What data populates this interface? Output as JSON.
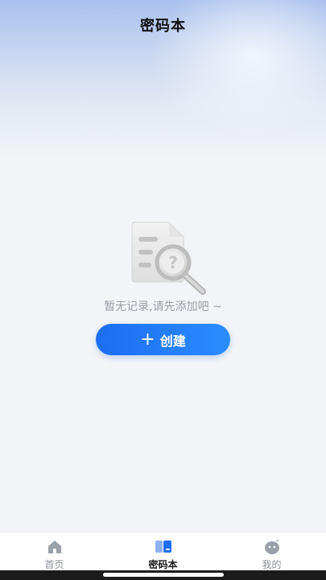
{
  "header": {
    "title": "密码本"
  },
  "empty_state": {
    "illustration": "document-search-icon",
    "message": "暂无记录,请先添加吧 ~"
  },
  "create_button": {
    "icon": "plus-icon",
    "label": "创建"
  },
  "tabbar": {
    "tabs": [
      {
        "label": "首页",
        "icon": "home-icon",
        "active": false
      },
      {
        "label": "密码本",
        "icon": "book-icon",
        "active": true
      },
      {
        "label": "我的",
        "icon": "profile-face-icon",
        "active": false
      }
    ]
  },
  "colors": {
    "accent": "#1d6df2",
    "accent_end": "#2a8cff",
    "background": "#f3f4f7",
    "header_gradient_top": "#a9c1ee"
  }
}
